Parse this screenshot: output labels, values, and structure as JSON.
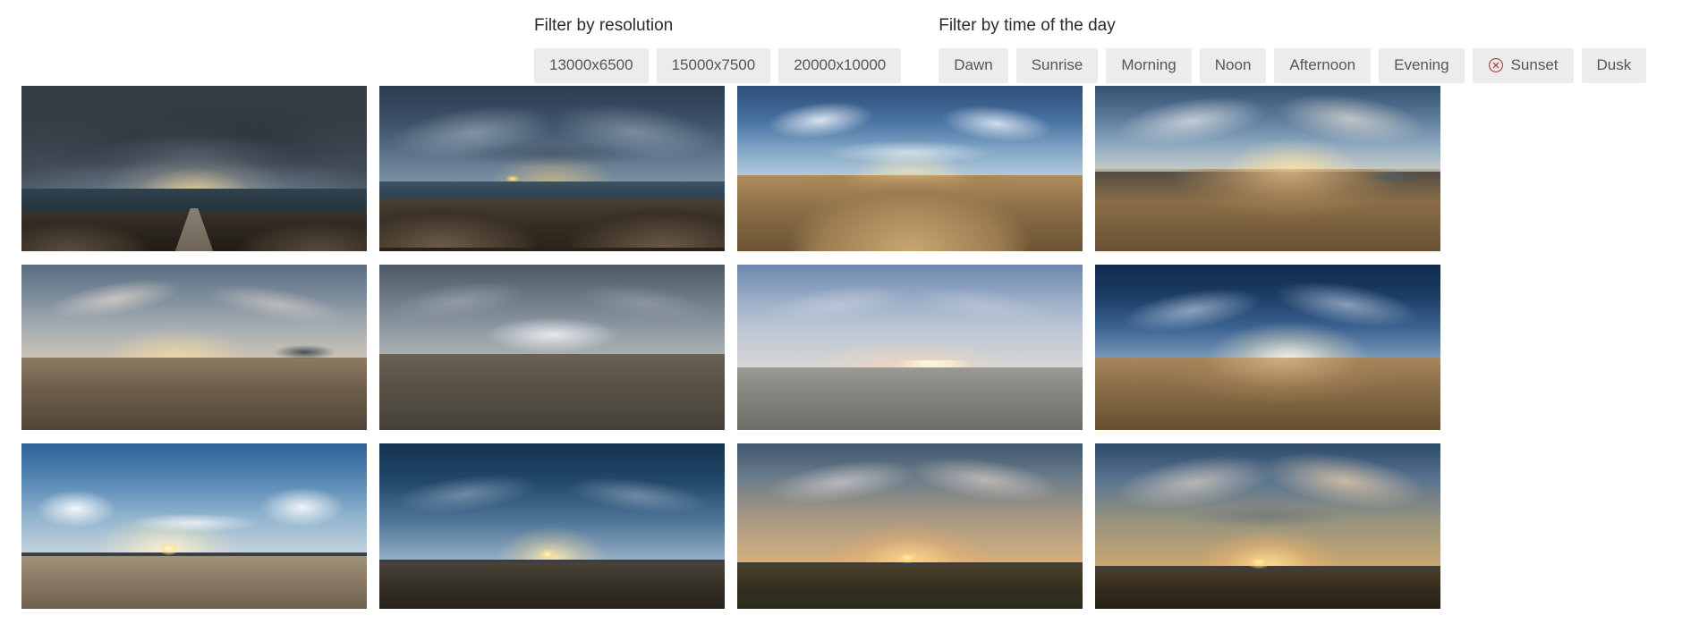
{
  "filters": [
    {
      "id": "resolution",
      "title": "Filter by resolution",
      "options": [
        {
          "label": "13000x6500",
          "selected": false
        },
        {
          "label": "15000x7500",
          "selected": false
        },
        {
          "label": "20000x10000",
          "selected": false
        }
      ]
    },
    {
      "id": "time_of_day",
      "title": "Filter by time of the day",
      "options": [
        {
          "label": "Dawn",
          "selected": false
        },
        {
          "label": "Sunrise",
          "selected": false
        },
        {
          "label": "Morning",
          "selected": false
        },
        {
          "label": "Noon",
          "selected": false
        },
        {
          "label": "Afternoon",
          "selected": false
        },
        {
          "label": "Evening",
          "selected": false
        },
        {
          "label": "Sunset",
          "selected": true,
          "icon": "clear-circle-x-icon"
        },
        {
          "label": "Dusk",
          "selected": false
        }
      ]
    }
  ],
  "colors": {
    "chip_background": "#ececec",
    "chip_text": "#555555",
    "heading_text": "#2b2b2b",
    "clear_icon": "#a33c3c",
    "page_background": "#ffffff"
  },
  "gallery": {
    "columns": 4,
    "items": [
      {
        "id": "pano-1",
        "variant": "p1",
        "alt": "360 panorama of a stone breakwater pier under heavy overcast clouds at dusk"
      },
      {
        "id": "pano-2",
        "variant": "p2",
        "alt": "360 panorama of coastal rocks and jetty at blue hour with distant town lights"
      },
      {
        "id": "pano-3",
        "variant": "p3",
        "alt": "360 panorama of golden sand dunes under a blue sky with cumulus clouds"
      },
      {
        "id": "pano-4",
        "variant": "p4",
        "alt": "360 panorama of warm hazy sand flats with low sun and a tidal pool"
      },
      {
        "id": "pano-5",
        "variant": "p5",
        "alt": "360 panorama of pale dawn sky over flat sand with a reflecting lagoon"
      },
      {
        "id": "pano-6",
        "variant": "p6",
        "alt": "360 panorama of a grey flat plain with a bright cloud bank on the horizon"
      },
      {
        "id": "pano-7",
        "variant": "p7",
        "alt": "360 panorama of pale blue twilight over grey sand with distant town glow"
      },
      {
        "id": "pano-8",
        "variant": "p8",
        "alt": "360 panorama of deep blue sky with bright sun over rippled sand"
      },
      {
        "id": "pano-9",
        "variant": "p9",
        "alt": "360 panorama of bright blue sky with cumulus clouds and low sun over a beach"
      },
      {
        "id": "pano-10",
        "variant": "p10",
        "alt": "360 panorama of deep navy sky with the sun setting on the horizon"
      },
      {
        "id": "pano-11",
        "variant": "p11",
        "alt": "360 panorama of a golden sunset over a dark ridge line"
      },
      {
        "id": "pano-12",
        "variant": "p12",
        "alt": "360 panorama of dramatic orange and grey sunset clouds above a dark field"
      }
    ]
  }
}
